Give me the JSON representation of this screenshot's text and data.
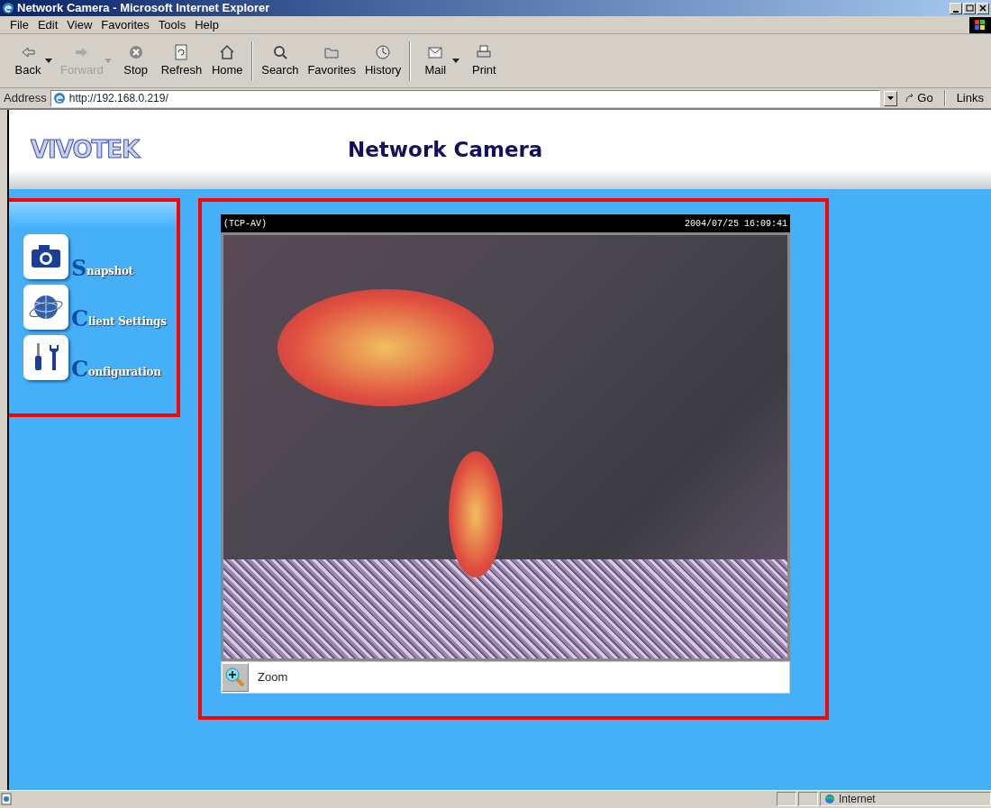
{
  "window": {
    "title": "Network Camera - Microsoft Internet Explorer"
  },
  "menu": [
    "File",
    "Edit",
    "View",
    "Favorites",
    "Tools",
    "Help"
  ],
  "toolbar": [
    {
      "label": "Back",
      "kind": "back",
      "disabled": false,
      "dropdown": true
    },
    {
      "label": "Forward",
      "kind": "forward",
      "disabled": true,
      "dropdown": true
    },
    {
      "label": "Stop",
      "kind": "stop",
      "disabled": false,
      "dropdown": false
    },
    {
      "label": "Refresh",
      "kind": "refresh",
      "disabled": false,
      "dropdown": false
    },
    {
      "label": "Home",
      "kind": "home",
      "disabled": false,
      "dropdown": false,
      "separator_after": true
    },
    {
      "label": "Search",
      "kind": "search",
      "disabled": false,
      "dropdown": false
    },
    {
      "label": "Favorites",
      "kind": "favorites",
      "disabled": false,
      "dropdown": false
    },
    {
      "label": "History",
      "kind": "history",
      "disabled": false,
      "dropdown": false,
      "separator_after": true
    },
    {
      "label": "Mail",
      "kind": "mail",
      "disabled": false,
      "dropdown": true
    },
    {
      "label": "Print",
      "kind": "print",
      "disabled": false,
      "dropdown": false
    }
  ],
  "address_bar": {
    "label": "Address",
    "url": "http://192.168.0.219/",
    "go": "Go",
    "links": "Links"
  },
  "page": {
    "logo": "VIVOTEK",
    "heading": "Network Camera",
    "nav": {
      "highlighted": true,
      "items": [
        {
          "label": "Snapshot",
          "kind": "camera"
        },
        {
          "label": "Client Settings",
          "kind": "globe"
        },
        {
          "label": "Configuration",
          "kind": "tools"
        }
      ]
    },
    "viewer": {
      "highlighted": true,
      "stream": "(TCP-AV)",
      "timestamp": "2004/07/25 16:09:41",
      "zoom": "Zoom"
    }
  },
  "status_bar": {
    "zone": "Internet"
  }
}
